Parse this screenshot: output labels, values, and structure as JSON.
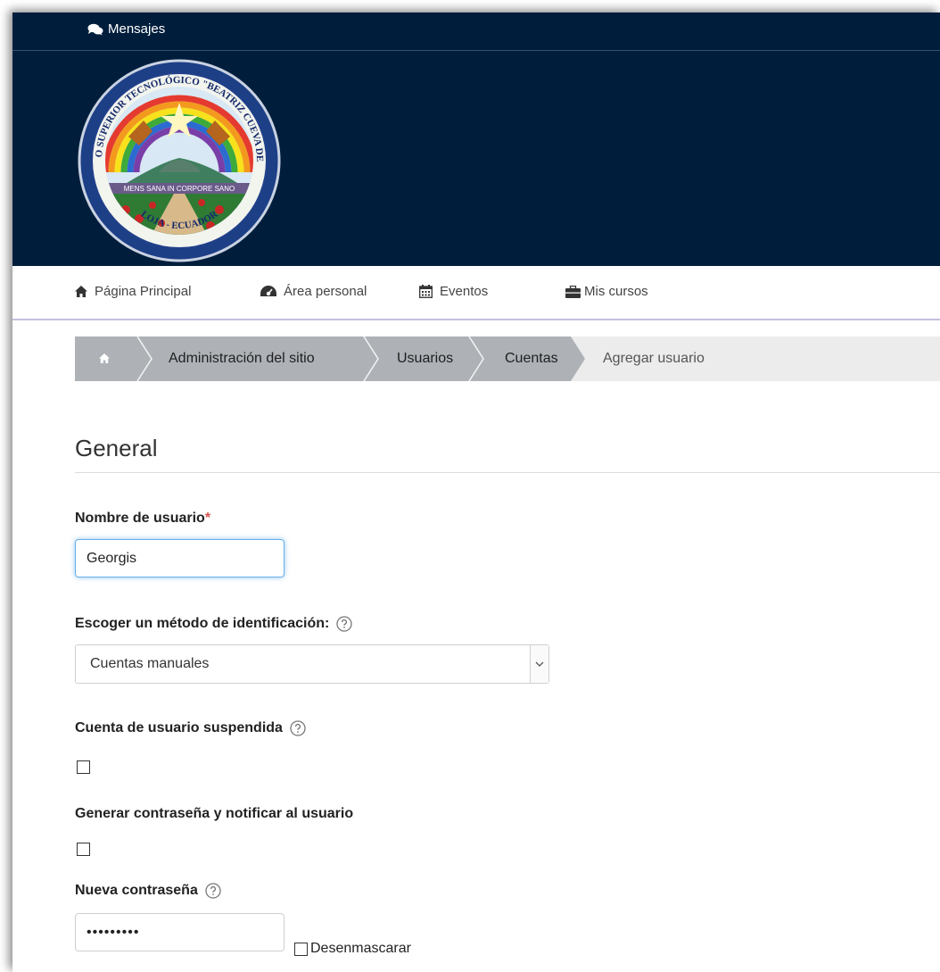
{
  "topbar": {
    "messages_label": "Mensajes"
  },
  "header": {
    "logo": {
      "seal_text": "INSTITUTO SUPERIOR TECNOLÓGICO \"BEATRIZ CUEVA DE AYORA\"",
      "bottom_text": "LOJA - ECUADOR",
      "motto": "MENS SANA IN CORPORE SANO"
    }
  },
  "nav": {
    "items": [
      {
        "label": "Página Principal",
        "icon": "home-icon"
      },
      {
        "label": "Área personal",
        "icon": "dashboard-icon"
      },
      {
        "label": "Eventos",
        "icon": "calendar-icon"
      },
      {
        "label": "Mis cursos",
        "icon": "briefcase-icon"
      }
    ]
  },
  "breadcrumb": {
    "items": [
      "Administración del sitio",
      "Usuarios",
      "Cuentas"
    ],
    "current": "Agregar usuario"
  },
  "form": {
    "section_title": "General",
    "username": {
      "label": "Nombre de usuario",
      "required_mark": "*",
      "value": "Georgis"
    },
    "auth_method": {
      "label": "Escoger un método de identificación:",
      "selected": "Cuentas manuales"
    },
    "suspended": {
      "label": "Cuenta de usuario suspendida",
      "checked": false
    },
    "generate_password": {
      "label": "Generar contraseña y notificar al usuario",
      "checked": false
    },
    "new_password": {
      "label": "Nueva contraseña",
      "masked_value": "•••••••••",
      "unmask_label": "Desenmascarar"
    }
  },
  "colors": {
    "header_bg": "#001e3c",
    "breadcrumb_active": "#aeb2b7",
    "required": "#d9534f",
    "focus": "#66afe9"
  }
}
